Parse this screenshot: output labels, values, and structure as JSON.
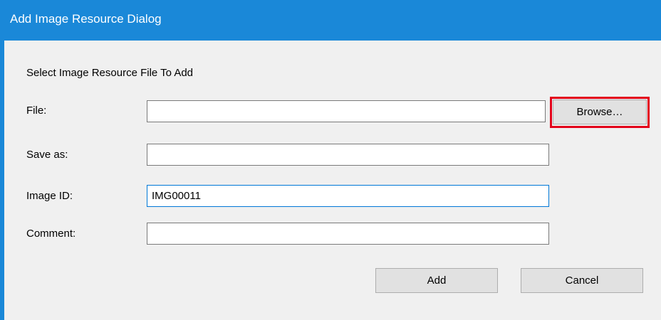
{
  "window": {
    "title": "Add Image Resource Dialog"
  },
  "form": {
    "instruction": "Select Image Resource File To Add",
    "file": {
      "label": "File:",
      "value": ""
    },
    "save_as": {
      "label": "Save as:",
      "value": ""
    },
    "image_id": {
      "label": "Image ID:",
      "value": "IMG00011"
    },
    "comment": {
      "label": "Comment:",
      "value": ""
    }
  },
  "buttons": {
    "browse_label": "Browse…",
    "add_label": "Add",
    "cancel_label": "Cancel"
  },
  "colors": {
    "titlebar": "#1a88d8",
    "highlight": "#e3001b",
    "client_background": "#f0f0f0"
  }
}
